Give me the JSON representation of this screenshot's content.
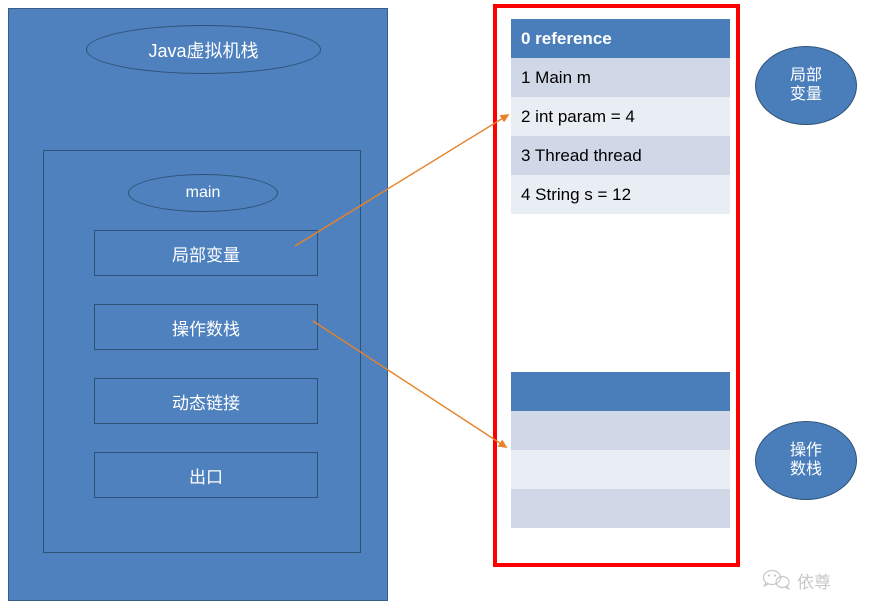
{
  "left_panel": {
    "title": "Java虚拟机栈",
    "frame": {
      "name": "main",
      "slots": [
        {
          "label": "局部变量"
        },
        {
          "label": "操作数栈"
        },
        {
          "label": "动态链接"
        },
        {
          "label": "出口"
        }
      ]
    }
  },
  "right_panel": {
    "border_color": "#FF0000",
    "locals_table": {
      "header": "0 reference",
      "rows": [
        "1 Main m",
        "2 int param = 4",
        "3 Thread thread",
        "4 String s = 12"
      ]
    },
    "operand_table": {
      "header": "",
      "rows": [
        "",
        "",
        ""
      ]
    }
  },
  "callouts": [
    {
      "line1": "局部",
      "line2": "变量"
    },
    {
      "line1": "操作",
      "line2": "数栈"
    }
  ],
  "watermark": {
    "text": "依尊"
  },
  "colors": {
    "panel_blue": "#4E81BD",
    "panel_border": "#385D8A",
    "table_header": "#4A7EBB",
    "row_odd": "#D0D8E8",
    "row_even": "#E9EDF4",
    "arrow": "#E8822A"
  }
}
